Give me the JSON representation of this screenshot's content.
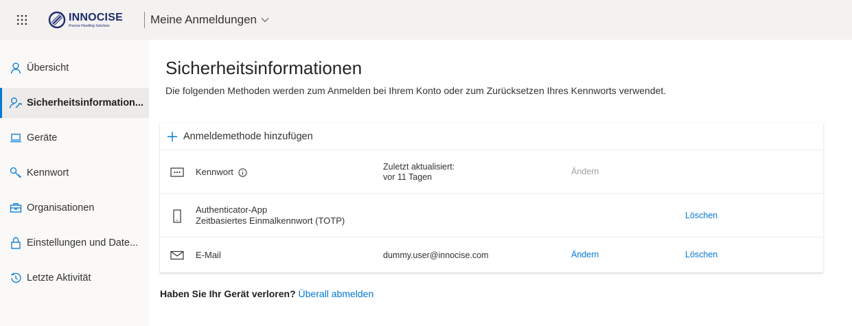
{
  "header": {
    "waffle_icon": "app-launcher-icon",
    "logo": {
      "name": "INNOCISE",
      "tagline": "Precise Handling Solutions"
    },
    "app_title": "Meine Anmeldungen"
  },
  "sidebar": {
    "items": [
      {
        "label": "Übersicht",
        "icon": "person-icon",
        "active": false
      },
      {
        "label": "Sicherheitsinformation...",
        "icon": "person-key-icon",
        "active": true
      },
      {
        "label": "Geräte",
        "icon": "laptop-icon",
        "active": false
      },
      {
        "label": "Kennwort",
        "icon": "key-icon",
        "active": false
      },
      {
        "label": "Organisationen",
        "icon": "briefcase-icon",
        "active": false
      },
      {
        "label": "Einstellungen und Date...",
        "icon": "lock-icon",
        "active": false
      },
      {
        "label": "Letzte Aktivität",
        "icon": "history-icon",
        "active": false
      }
    ]
  },
  "main": {
    "title": "Sicherheitsinformationen",
    "description": "Die folgenden Methoden werden zum Anmelden bei Ihrem Konto oder zum Zurücksetzen Ihres Kennworts verwendet.",
    "add_method": "Anmeldemethode hinzufügen",
    "methods": [
      {
        "name": "Kennwort",
        "icon": "password-icon",
        "detail_line1": "Zuletzt aktualisiert:",
        "detail_line2": "vor 11 Tagen",
        "action1": "Ändern",
        "action2": ""
      },
      {
        "name": "Authenticator-App",
        "subname": "Zeitbasiertes Einmalkennwort (TOTP)",
        "icon": "phone-icon",
        "detail_line1": "",
        "action1": "",
        "action2": "Löschen"
      },
      {
        "name": "E-Mail",
        "icon": "mail-icon",
        "detail_line1": "dummy.user@innocise.com",
        "action1": "Ändern",
        "action2": "Löschen"
      }
    ],
    "lost_device": {
      "question": "Haben Sie Ihr Gerät verloren?",
      "link": "Überall abmelden"
    }
  },
  "colors": {
    "accent": "#0078d4",
    "brand": "#1c2b6b",
    "disabled": "#a19f9d"
  }
}
